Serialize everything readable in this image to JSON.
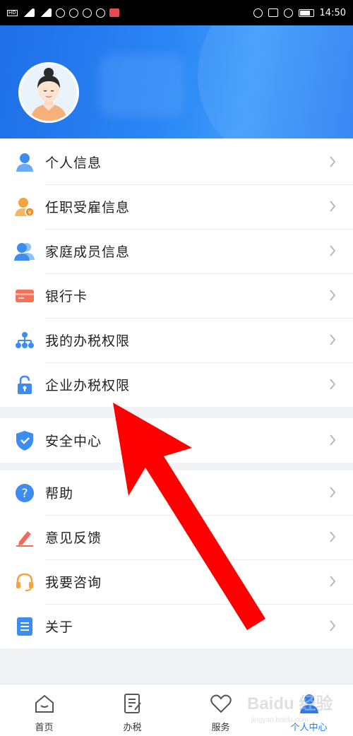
{
  "status_bar": {
    "time": "14:50",
    "left_icons": [
      "hd-icon",
      "signal-icon",
      "signal-icon",
      "wifi-icon",
      "qq-icon",
      "message-icon",
      "app-icon",
      "notification-icon"
    ],
    "right_icons": [
      "headset-icon",
      "nfc-icon",
      "alarm-icon",
      "battery-icon"
    ]
  },
  "profile": {
    "avatar_icon": "user-avatar-icon"
  },
  "menu_group_1": [
    {
      "label": "个人信息",
      "icon": "person-icon"
    },
    {
      "label": "任职受雇信息",
      "icon": "employment-icon"
    },
    {
      "label": "家庭成员信息",
      "icon": "family-icon"
    },
    {
      "label": "银行卡",
      "icon": "bank-card-icon"
    },
    {
      "label": "我的办税权限",
      "icon": "org-chart-icon"
    },
    {
      "label": "企业办税权限",
      "icon": "lock-icon"
    }
  ],
  "menu_group_2": [
    {
      "label": "安全中心",
      "icon": "shield-icon"
    }
  ],
  "menu_group_3": [
    {
      "label": "帮助",
      "icon": "help-icon"
    },
    {
      "label": "意见反馈",
      "icon": "pen-icon"
    },
    {
      "label": "我要咨询",
      "icon": "headset-icon"
    },
    {
      "label": "关于",
      "icon": "document-icon"
    }
  ],
  "tab_bar": [
    {
      "label": "首页",
      "icon": "home-icon",
      "active": false
    },
    {
      "label": "办税",
      "icon": "tax-form-icon",
      "active": false
    },
    {
      "label": "服务",
      "icon": "service-heart-icon",
      "active": false
    },
    {
      "label": "个人中心",
      "icon": "profile-icon",
      "active": true
    }
  ],
  "colors": {
    "brand_blue": "#2a7bf0",
    "arrow_red": "#ff0000",
    "chevron": "#b5b5b5"
  },
  "watermark": {
    "text": "Baidu 经验",
    "sub": "jingyan.baidu.com"
  }
}
